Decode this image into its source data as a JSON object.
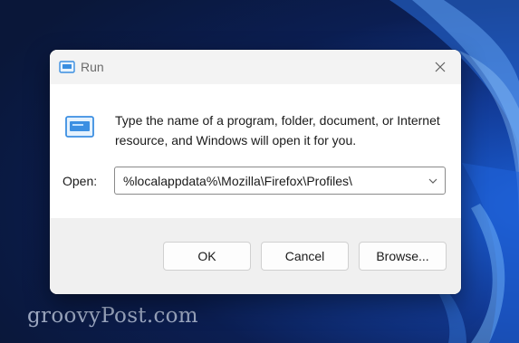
{
  "dialog": {
    "title": "Run",
    "icon": "run-icon",
    "description": "Type the name of a program, folder, document, or Internet resource, and Windows will open it for you.",
    "open_label": "Open:",
    "open_value": "%localappdata%\\Mozilla\\Firefox\\Profiles\\",
    "buttons": {
      "ok": "OK",
      "cancel": "Cancel",
      "browse": "Browse..."
    }
  },
  "watermark": "groovyPost.com",
  "colors": {
    "desktop_accent": "#1b5fd6",
    "titlebar": "#f3f3f3",
    "footer": "#f0f0f0",
    "run_icon_blue": "#2d8ae3"
  }
}
